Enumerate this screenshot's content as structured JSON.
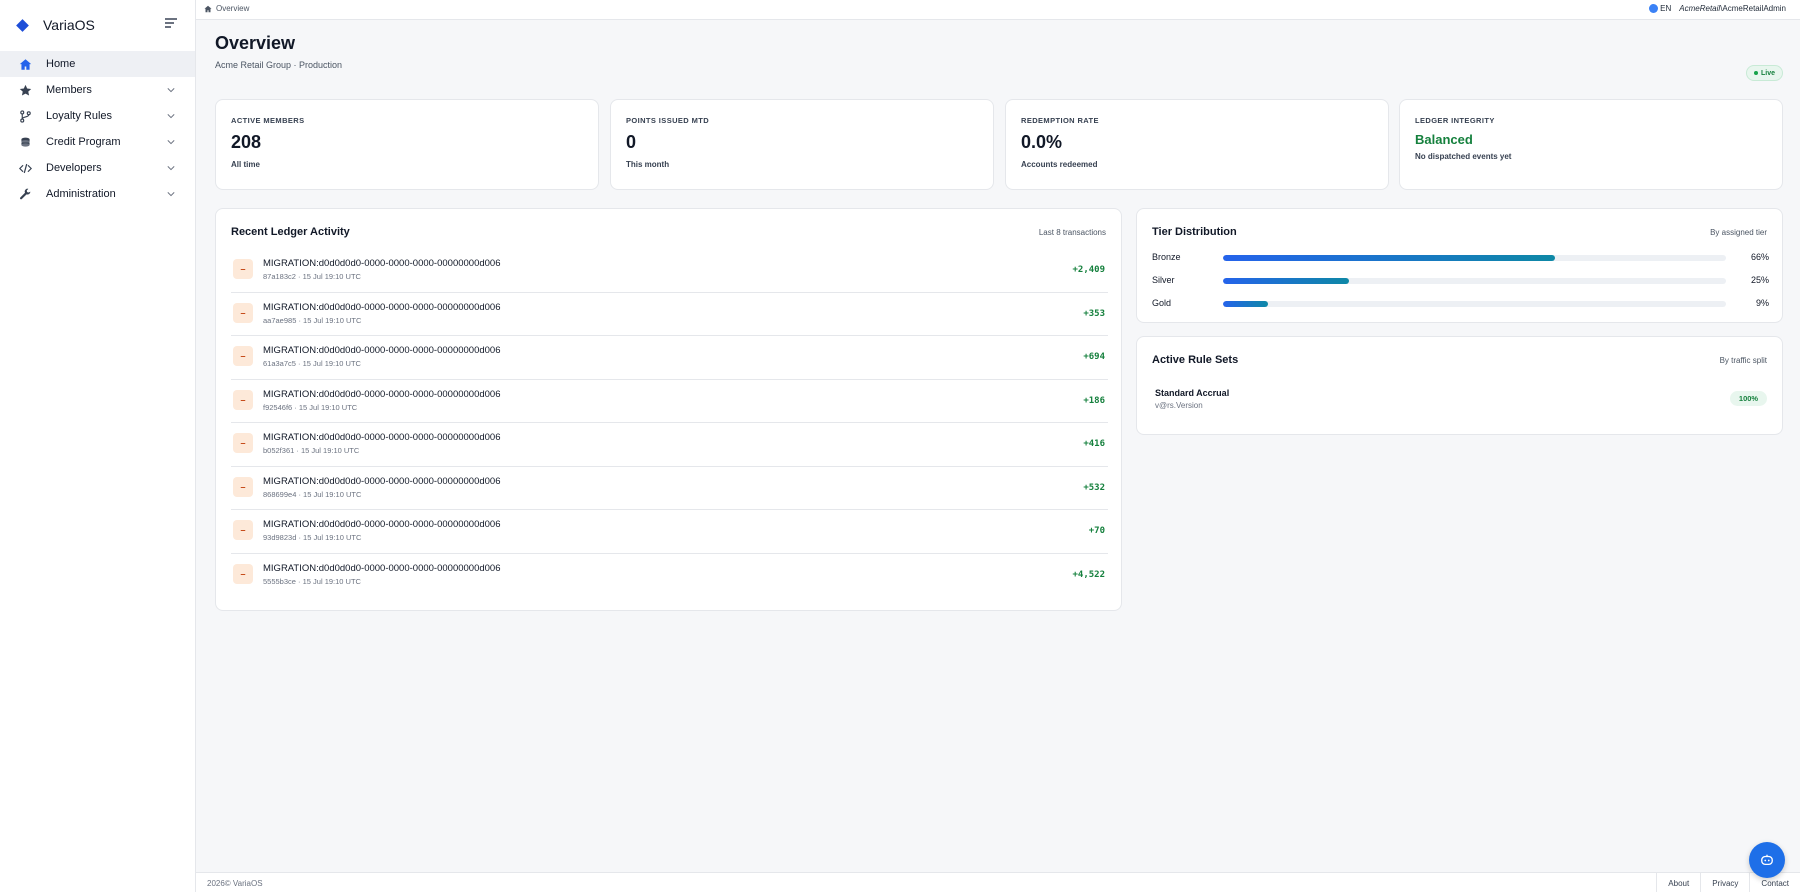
{
  "app": {
    "name": "VariaOS"
  },
  "sidebar": {
    "items": [
      {
        "label": "Home",
        "icon": "home-icon",
        "active": true
      },
      {
        "label": "Members",
        "icon": "star-icon"
      },
      {
        "label": "Loyalty Rules",
        "icon": "branch-icon"
      },
      {
        "label": "Credit Program",
        "icon": "coins-icon"
      },
      {
        "label": "Developers",
        "icon": "code-icon"
      },
      {
        "label": "Administration",
        "icon": "wrench-icon"
      }
    ]
  },
  "topbar": {
    "breadcrumb": "Overview",
    "lang": "EN",
    "tenant": "AcmeRetail",
    "user": "\\AcmeRetailAdmin"
  },
  "page": {
    "title": "Overview",
    "subtitle": "Acme Retail Group · Production",
    "status": "Live"
  },
  "stats": [
    {
      "label": "ACTIVE MEMBERS",
      "value": "208",
      "note": "All time"
    },
    {
      "label": "POINTS ISSUED MTD",
      "value": "0",
      "note": "This month"
    },
    {
      "label": "REDEMPTION RATE",
      "value": "0.0%",
      "note": "Accounts redeemed"
    },
    {
      "label": "LEDGER INTEGRITY",
      "value": "Balanced",
      "note": "No dispatched events yet",
      "color": "#15803d"
    }
  ],
  "ledger": {
    "title": "Recent Ledger Activity",
    "meta": "Last 8 transactions",
    "rows": [
      {
        "badge": "–",
        "ref": "MIGRATION:d0d0d0d0-0000-0000-0000-00000000d006",
        "sub": "87a183c2 · 15 Jul 19:10 UTC",
        "amount": "+2,409"
      },
      {
        "badge": "–",
        "ref": "MIGRATION:d0d0d0d0-0000-0000-0000-00000000d006",
        "sub": "aa7ae985 · 15 Jul 19:10 UTC",
        "amount": "+353"
      },
      {
        "badge": "–",
        "ref": "MIGRATION:d0d0d0d0-0000-0000-0000-00000000d006",
        "sub": "61a3a7c5 · 15 Jul 19:10 UTC",
        "amount": "+694"
      },
      {
        "badge": "–",
        "ref": "MIGRATION:d0d0d0d0-0000-0000-0000-00000000d006",
        "sub": "f92546f6 · 15 Jul 19:10 UTC",
        "amount": "+186"
      },
      {
        "badge": "–",
        "ref": "MIGRATION:d0d0d0d0-0000-0000-0000-00000000d006",
        "sub": "b052f361 · 15 Jul 19:10 UTC",
        "amount": "+416"
      },
      {
        "badge": "–",
        "ref": "MIGRATION:d0d0d0d0-0000-0000-0000-00000000d006",
        "sub": "868699e4 · 15 Jul 19:10 UTC",
        "amount": "+532"
      },
      {
        "badge": "–",
        "ref": "MIGRATION:d0d0d0d0-0000-0000-0000-00000000d006",
        "sub": "93d9823d · 15 Jul 19:10 UTC",
        "amount": "+70"
      },
      {
        "badge": "–",
        "ref": "MIGRATION:d0d0d0d0-0000-0000-0000-00000000d006",
        "sub": "5555b3ce · 15 Jul 19:10 UTC",
        "amount": "+4,522"
      }
    ]
  },
  "tiers": {
    "title": "Tier Distribution",
    "meta": "By assigned tier",
    "items": [
      {
        "name": "Bronze",
        "percent": 66,
        "label": "66%"
      },
      {
        "name": "Silver",
        "percent": 25,
        "label": "25%"
      },
      {
        "name": "Gold",
        "percent": 9,
        "label": "9%"
      }
    ]
  },
  "rules": {
    "title": "Active Rule Sets",
    "meta": "By traffic split",
    "items": [
      {
        "name": "Standard Accrual",
        "version": "v@rs.Version",
        "split": "100%"
      }
    ]
  },
  "footer": {
    "copyright": "2026© VariaOS",
    "links": [
      "About",
      "Privacy",
      "Contact"
    ]
  },
  "colors": {
    "accent": "#1d4ed8",
    "positive": "#15803d",
    "badge_bg": "#fde9d9"
  }
}
